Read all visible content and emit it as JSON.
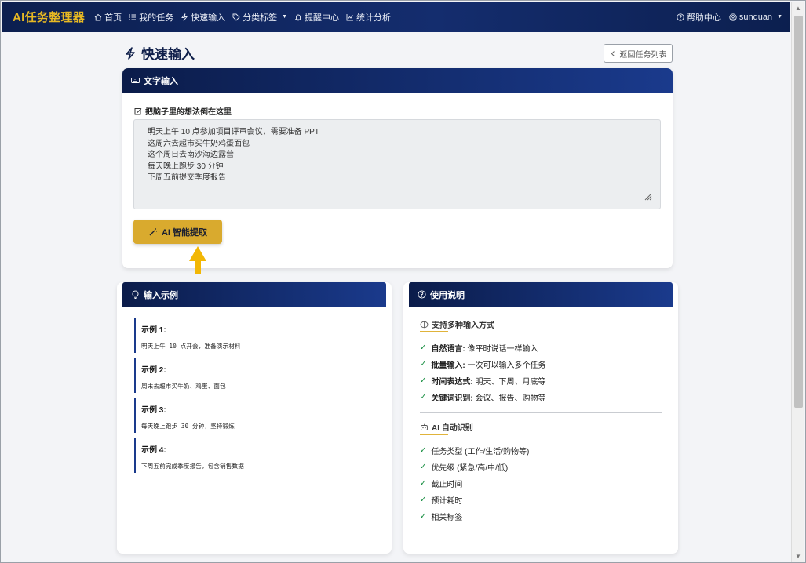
{
  "navbar": {
    "brand": "AI任务整理器",
    "items": [
      {
        "label": "首页",
        "icon": "home-icon"
      },
      {
        "label": "我的任务",
        "icon": "list-icon"
      },
      {
        "label": "快速输入",
        "icon": "bolt-icon"
      },
      {
        "label": "分类标签",
        "icon": "tag-icon",
        "dropdown": true
      },
      {
        "label": "提醒中心",
        "icon": "bell-icon"
      },
      {
        "label": "统计分析",
        "icon": "chart-icon"
      }
    ],
    "help_label": "帮助中心",
    "user_label": "sunquan"
  },
  "page": {
    "title": "快速输入",
    "back_label": "返回任务列表"
  },
  "input_card": {
    "header": "文字输入",
    "field_label": "把脑子里的想法倒在这里",
    "lines": [
      "明天上午 10 点参加项目评审会议，需要准备 PPT",
      "这周六去超市买牛奶鸡蛋面包",
      "这个周日去南沙海边露营",
      "每天晚上跑步 30 分钟",
      "下周五前提交季度报告"
    ],
    "button_label": "AI 智能提取"
  },
  "examples_card": {
    "header": "输入示例",
    "examples": [
      {
        "title": "示例 1:",
        "text": "明天上午 10 点开会，准备演示材料"
      },
      {
        "title": "示例 2:",
        "text": "周末去超市买牛奶、鸡蛋、面包"
      },
      {
        "title": "示例 3:",
        "text": "每天晚上跑步 30 分钟，坚持锻炼"
      },
      {
        "title": "示例 4:",
        "text": "下周五前完成季度报告，包含销售数据"
      }
    ]
  },
  "help_card": {
    "header": "使用说明",
    "section1_title": "支持多种输入方式",
    "section1_items": [
      {
        "bold": "自然语言:",
        "text": " 像平时说话一样输入"
      },
      {
        "bold": "批量输入:",
        "text": " 一次可以输入多个任务"
      },
      {
        "bold": "时间表达式:",
        "text": " 明天、下周、月底等"
      },
      {
        "bold": "关键词识别:",
        "text": " 会议、报告、购物等"
      }
    ],
    "section2_title": "AI 自动识别",
    "section2_items": [
      "任务类型 (工作/生活/购物等)",
      "优先级 (紧急/高/中/低)",
      "截止时间",
      "预计耗时",
      "相关标签"
    ]
  },
  "colors": {
    "navbar": "#0c1f4f",
    "brand": "#e8b923",
    "accent_button": "#d9aa2e",
    "check": "#1a8f43",
    "arrow": "#f2b705"
  }
}
